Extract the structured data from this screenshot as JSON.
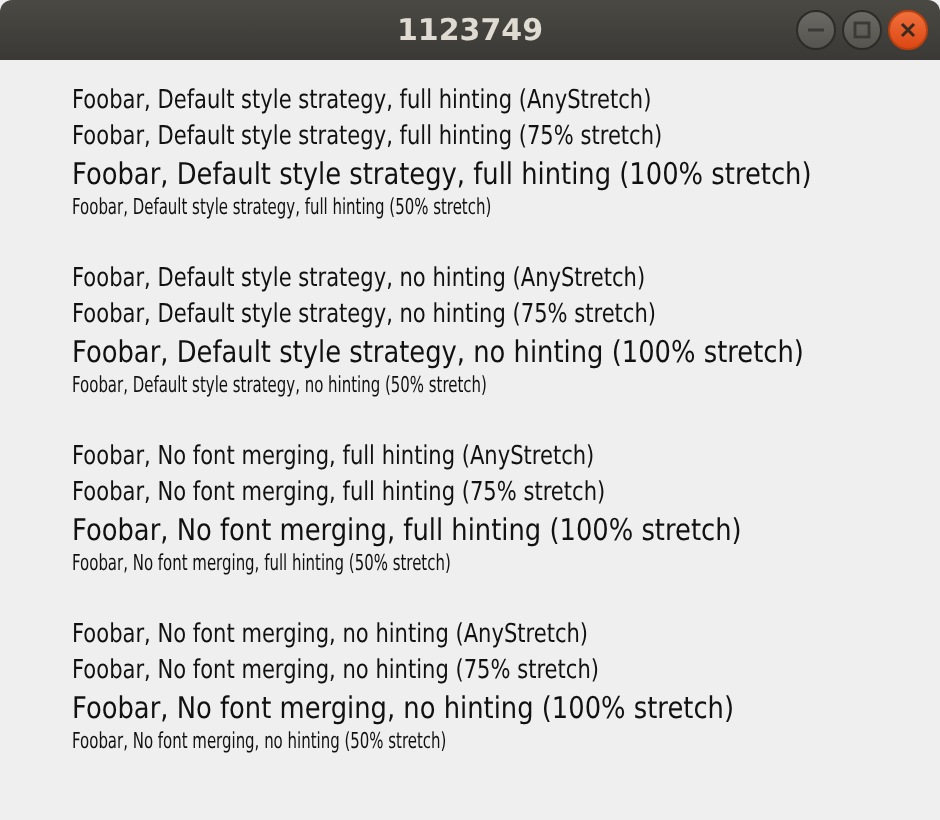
{
  "window": {
    "title": "1123749"
  },
  "groups": [
    {
      "lines": [
        {
          "text": "Foobar, Default style strategy, full hinting (AnyStretch)",
          "kind": "any"
        },
        {
          "text": "Foobar, Default style strategy, full hinting (75% stretch)",
          "kind": "s75"
        },
        {
          "text": "Foobar, Default style strategy, full hinting (100% stretch)",
          "kind": "s100"
        },
        {
          "text": "Foobar, Default style strategy, full hinting (50% stretch)",
          "kind": "s50"
        }
      ]
    },
    {
      "lines": [
        {
          "text": "Foobar, Default style strategy, no hinting (AnyStretch)",
          "kind": "any"
        },
        {
          "text": "Foobar, Default style strategy, no hinting (75% stretch)",
          "kind": "s75"
        },
        {
          "text": "Foobar, Default style strategy, no hinting (100% stretch)",
          "kind": "s100"
        },
        {
          "text": "Foobar, Default style strategy, no hinting (50% stretch)",
          "kind": "s50"
        }
      ]
    },
    {
      "lines": [
        {
          "text": "Foobar, No font merging, full hinting (AnyStretch)",
          "kind": "any"
        },
        {
          "text": "Foobar, No font merging, full hinting (75% stretch)",
          "kind": "s75"
        },
        {
          "text": "Foobar, No font merging, full hinting (100% stretch)",
          "kind": "s100"
        },
        {
          "text": "Foobar, No font merging, full hinting (50% stretch)",
          "kind": "s50"
        }
      ]
    },
    {
      "lines": [
        {
          "text": "Foobar, No font merging, no hinting (AnyStretch)",
          "kind": "any"
        },
        {
          "text": "Foobar, No font merging, no hinting (75% stretch)",
          "kind": "s75"
        },
        {
          "text": "Foobar, No font merging, no hinting (100% stretch)",
          "kind": "s100"
        },
        {
          "text": "Foobar, No font merging, no hinting (50% stretch)",
          "kind": "s50"
        }
      ]
    }
  ]
}
